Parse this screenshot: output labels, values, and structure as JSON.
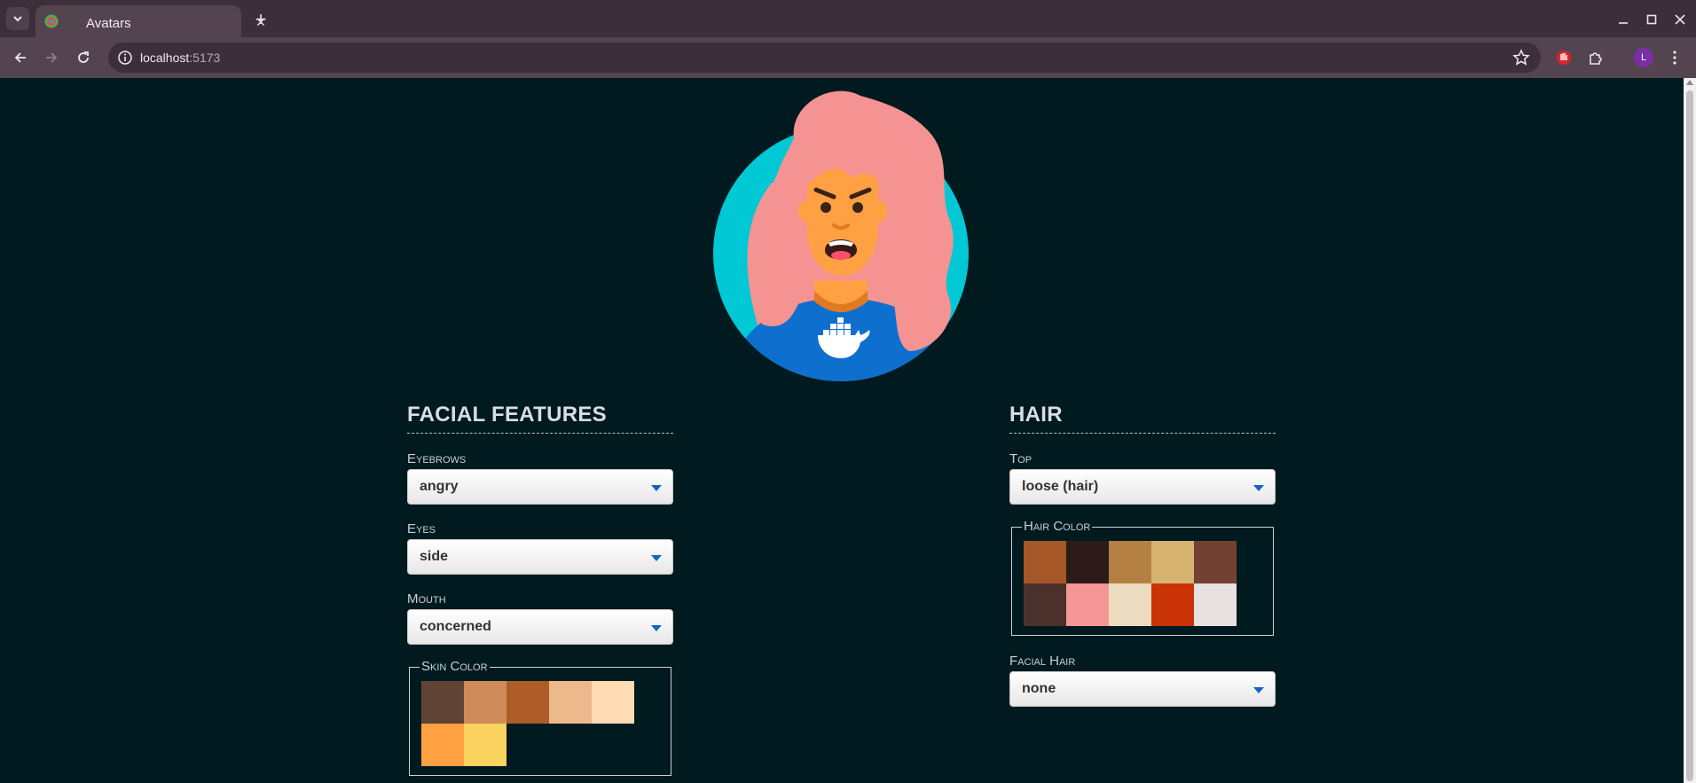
{
  "browser": {
    "tab_title": "Avatars",
    "url_host": "localhost",
    "url_port": ":5173",
    "profile_initial": "L"
  },
  "avatar": {
    "background_color": "#00c8d4",
    "hair_color": "#f49391",
    "skin_color": "#ffa042",
    "shirt_color": "#0f6fcf",
    "eyebrows": "angry",
    "eyes": "side",
    "mouth": "concerned"
  },
  "facial_features": {
    "title": "FACIAL FEATURES",
    "eyebrows": {
      "label": "Eyebrows",
      "value": "angry"
    },
    "eyes": {
      "label": "Eyes",
      "value": "side"
    },
    "mouth": {
      "label": "Mouth",
      "value": "concerned"
    },
    "skin_color": {
      "label": "Skin Color",
      "swatches": [
        "#614335",
        "#d08b5b",
        "#ae5d29",
        "#edb98a",
        "#ffdbb4",
        "#ffa042",
        "#f9d35d"
      ]
    }
  },
  "hair": {
    "title": "HAIR",
    "top": {
      "label": "Top",
      "value": "loose (hair)"
    },
    "hair_color": {
      "label": "Hair Color",
      "swatches": [
        "#a55728",
        "#2c1b18",
        "#b58143",
        "#d6b370",
        "#724133",
        "#4a312c",
        "#f59797",
        "#ecdcbf",
        "#c93305",
        "#e8e1e1"
      ]
    },
    "facial_hair": {
      "label": "Facial Hair",
      "value": "none"
    }
  }
}
